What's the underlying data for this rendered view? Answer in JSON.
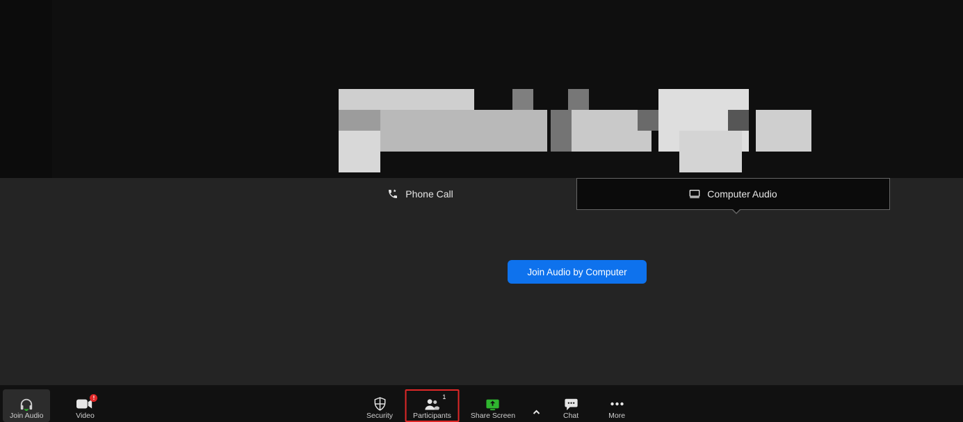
{
  "tabs": {
    "phone_label": "Phone Call",
    "computer_label": "Computer Audio"
  },
  "dialog": {
    "join_button_label": "Join Audio by Computer"
  },
  "toolbar": {
    "join_audio_label": "Join Audio",
    "video_label": "Video",
    "video_badge": "!",
    "security_label": "Security",
    "participants_label": "Participants",
    "participants_count": "1",
    "share_screen_label": "Share Screen",
    "chat_label": "Chat",
    "more_label": "More"
  },
  "colors": {
    "accent": "#0e72ed",
    "share_green": "#2fb62f",
    "alert_red": "#e02828"
  }
}
